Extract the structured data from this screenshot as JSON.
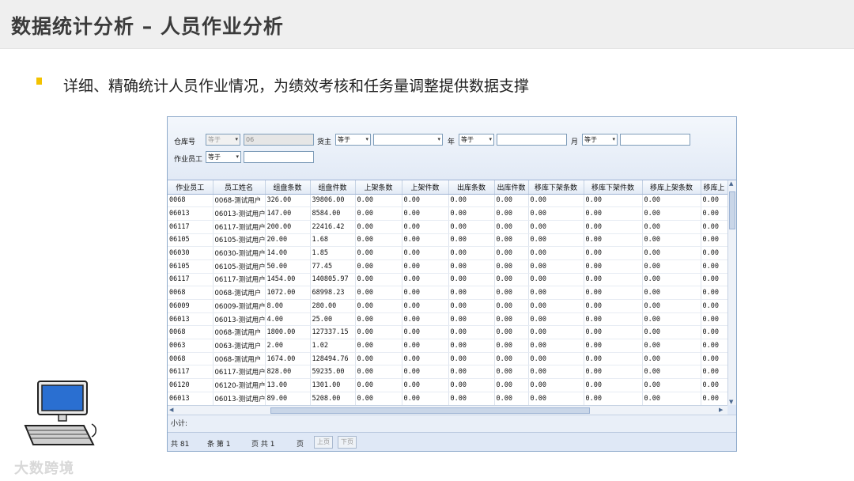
{
  "slide": {
    "title": "数据统计分析 – 人员作业分析",
    "bullet": "详细、精确统计人员作业情况，为绩效考核和任务量调整提供数据支撑",
    "watermark": "大数跨境",
    "bullet_color": "#f3c200"
  },
  "filter": {
    "warehouse_label": "仓库号",
    "warehouse_op": "等于",
    "warehouse_value": "06",
    "owner_label": "货主",
    "owner_op": "等于",
    "owner_value": "",
    "year_label": "年",
    "year_op": "等于",
    "month_label": "月",
    "month_op": "等于",
    "worker_label": "作业员工",
    "worker_op": "等于"
  },
  "table": {
    "columns": [
      "作业员工",
      "员工姓名",
      "组盘条数",
      "组盘件数",
      "上架条数",
      "上架件数",
      "出库条数",
      "出库件数",
      "移库下架条数",
      "移库下架件数",
      "移库上架条数",
      "移库上"
    ],
    "rows": [
      [
        "0068",
        "0068-测试用户",
        "326.00",
        "39806.00",
        "0.00",
        "0.00",
        "0.00",
        "0.00",
        "0.00",
        "0.00",
        "0.00",
        "0.00"
      ],
      [
        "06013",
        "06013-测试用户",
        "147.00",
        "8584.00",
        "0.00",
        "0.00",
        "0.00",
        "0.00",
        "0.00",
        "0.00",
        "0.00",
        "0.00"
      ],
      [
        "06117",
        "06117-测试用户",
        "200.00",
        "22416.42",
        "0.00",
        "0.00",
        "0.00",
        "0.00",
        "0.00",
        "0.00",
        "0.00",
        "0.00"
      ],
      [
        "06105",
        "06105-测试用户",
        "20.00",
        "1.68",
        "0.00",
        "0.00",
        "0.00",
        "0.00",
        "0.00",
        "0.00",
        "0.00",
        "0.00"
      ],
      [
        "06030",
        "06030-测试用户",
        "14.00",
        "1.85",
        "0.00",
        "0.00",
        "0.00",
        "0.00",
        "0.00",
        "0.00",
        "0.00",
        "0.00"
      ],
      [
        "06105",
        "06105-测试用户",
        "50.00",
        "77.45",
        "0.00",
        "0.00",
        "0.00",
        "0.00",
        "0.00",
        "0.00",
        "0.00",
        "0.00"
      ],
      [
        "06117",
        "06117-测试用户",
        "1454.00",
        "140805.97",
        "0.00",
        "0.00",
        "0.00",
        "0.00",
        "0.00",
        "0.00",
        "0.00",
        "0.00"
      ],
      [
        "0068",
        "0068-测试用户",
        "1072.00",
        "68998.23",
        "0.00",
        "0.00",
        "0.00",
        "0.00",
        "0.00",
        "0.00",
        "0.00",
        "0.00"
      ],
      [
        "06009",
        "06009-测试用户",
        "8.00",
        "280.00",
        "0.00",
        "0.00",
        "0.00",
        "0.00",
        "0.00",
        "0.00",
        "0.00",
        "0.00"
      ],
      [
        "06013",
        "06013-测试用户",
        "4.00",
        "25.00",
        "0.00",
        "0.00",
        "0.00",
        "0.00",
        "0.00",
        "0.00",
        "0.00",
        "0.00"
      ],
      [
        "0068",
        "0068-测试用户",
        "1800.00",
        "127337.15",
        "0.00",
        "0.00",
        "0.00",
        "0.00",
        "0.00",
        "0.00",
        "0.00",
        "0.00"
      ],
      [
        "0063",
        "0063-测试用户",
        "2.00",
        "1.02",
        "0.00",
        "0.00",
        "0.00",
        "0.00",
        "0.00",
        "0.00",
        "0.00",
        "0.00"
      ],
      [
        "0068",
        "0068-测试用户",
        "1674.00",
        "128494.76",
        "0.00",
        "0.00",
        "0.00",
        "0.00",
        "0.00",
        "0.00",
        "0.00",
        "0.00"
      ],
      [
        "06117",
        "06117-测试用户",
        "828.00",
        "59235.00",
        "0.00",
        "0.00",
        "0.00",
        "0.00",
        "0.00",
        "0.00",
        "0.00",
        "0.00"
      ],
      [
        "06120",
        "06120-测试用户",
        "13.00",
        "1301.00",
        "0.00",
        "0.00",
        "0.00",
        "0.00",
        "0.00",
        "0.00",
        "0.00",
        "0.00"
      ],
      [
        "06013",
        "06013-测试用户",
        "89.00",
        "5208.00",
        "0.00",
        "0.00",
        "0.00",
        "0.00",
        "0.00",
        "0.00",
        "0.00",
        "0.00"
      ]
    ]
  },
  "footer": {
    "subtotal_label": "小计:",
    "total_label": "共 81",
    "page_label": "条 第 1",
    "pages_label": "页 共 1",
    "page_suffix": "页",
    "prev_label": "上页",
    "next_label": "下页"
  }
}
